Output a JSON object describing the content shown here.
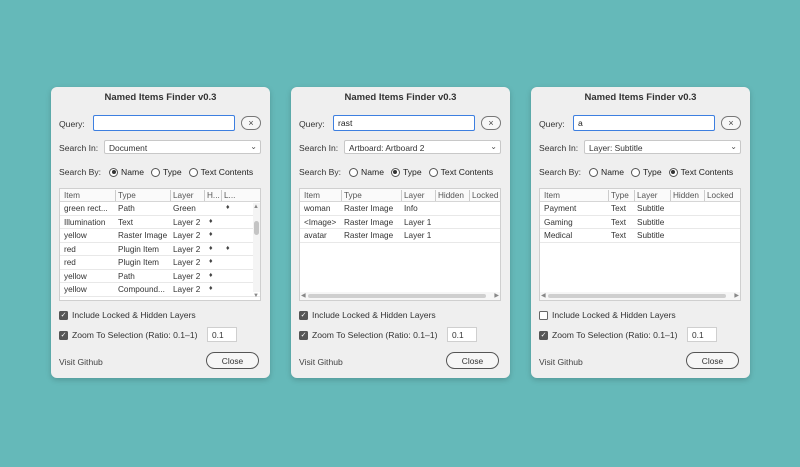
{
  "dialogs": [
    {
      "title": "Named Items Finder v0.3",
      "query_label": "Query:",
      "query_value": "",
      "clear_icon": "×",
      "search_in_label": "Search In:",
      "search_in_value": "Document",
      "search_by_label": "Search By:",
      "radio_options": [
        "Name",
        "Type",
        "Text Contents"
      ],
      "radio_selected": 0,
      "columns": [
        "Item",
        "Type",
        "Layer",
        "H...",
        "L..."
      ],
      "rows": [
        [
          "green rect...",
          "Path",
          "Green",
          "",
          "♦"
        ],
        [
          "Illumination",
          "Text",
          "Layer 2",
          "♦",
          ""
        ],
        [
          "yellow",
          "Raster Image",
          "Layer 2",
          "♦",
          ""
        ],
        [
          "red",
          "Plugin Item",
          "Layer 2",
          "♦",
          "♦"
        ],
        [
          "red",
          "Plugin Item",
          "Layer 2",
          "♦",
          ""
        ],
        [
          "yellow",
          "Path",
          "Layer 2",
          "♦",
          ""
        ],
        [
          "yellow",
          "Compound...",
          "Layer 2",
          "♦",
          ""
        ]
      ],
      "include_locked_label": "Include Locked & Hidden Layers",
      "include_locked_checked": true,
      "zoom_label": "Zoom To Selection (Ratio: 0.1–1)",
      "zoom_checked": true,
      "zoom_ratio": "0.1",
      "github_label": "Visit Github",
      "close_label": "Close"
    },
    {
      "title": "Named Items Finder v0.3",
      "query_label": "Query:",
      "query_value": "rast",
      "clear_icon": "×",
      "search_in_label": "Search In:",
      "search_in_value": "Artboard: Artboard 2",
      "search_by_label": "Search By:",
      "radio_options": [
        "Name",
        "Type",
        "Text Contents"
      ],
      "radio_selected": 1,
      "columns": [
        "Item",
        "Type",
        "Layer",
        "Hidden",
        "Locked"
      ],
      "rows": [
        [
          "woman",
          "Raster Image",
          "Info",
          "",
          ""
        ],
        [
          "<Image>",
          "Raster Image",
          "Layer 1",
          "",
          ""
        ],
        [
          "avatar",
          "Raster Image",
          "Layer 1",
          "",
          ""
        ]
      ],
      "include_locked_label": "Include Locked & Hidden Layers",
      "include_locked_checked": true,
      "zoom_label": "Zoom To Selection (Ratio: 0.1–1)",
      "zoom_checked": true,
      "zoom_ratio": "0.1",
      "github_label": "Visit Github",
      "close_label": "Close"
    },
    {
      "title": "Named Items Finder v0.3",
      "query_label": "Query:",
      "query_value": "a",
      "clear_icon": "×",
      "search_in_label": "Search In:",
      "search_in_value": "Layer: Subtitle",
      "search_by_label": "Search By:",
      "radio_options": [
        "Name",
        "Type",
        "Text Contents"
      ],
      "radio_selected": 2,
      "columns": [
        "Item",
        "Type",
        "Layer",
        "Hidden",
        "Locked"
      ],
      "rows": [
        [
          "Payment",
          "Text",
          "Subtitle",
          "",
          ""
        ],
        [
          "Gaming",
          "Text",
          "Subtitle",
          "",
          ""
        ],
        [
          "Medical",
          "Text",
          "Subtitle",
          "",
          ""
        ]
      ],
      "include_locked_label": "Include Locked & Hidden Layers",
      "include_locked_checked": false,
      "zoom_label": "Zoom To Selection (Ratio: 0.1–1)",
      "zoom_checked": true,
      "zoom_ratio": "0.1",
      "github_label": "Visit Github",
      "close_label": "Close"
    }
  ]
}
